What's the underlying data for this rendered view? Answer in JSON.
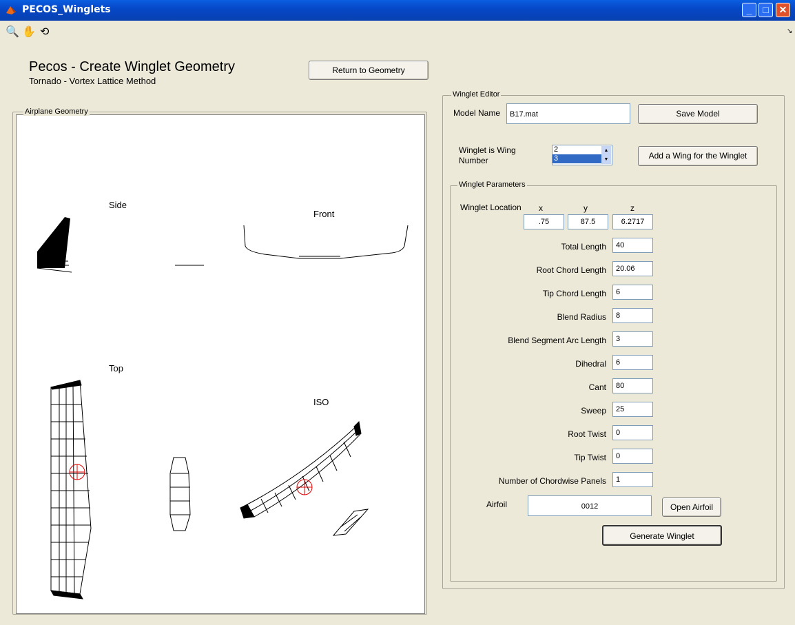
{
  "window": {
    "title": "PECOS_Winglets"
  },
  "toolbar": {
    "icons": [
      "zoom-in-icon",
      "pan-hand-icon",
      "rotate-3d-icon"
    ]
  },
  "header": {
    "title": "Pecos - Create Winglet Geometry",
    "subtitle": "Tornado - Vortex Lattice Method",
    "return_button": "Return to Geometry"
  },
  "geometry_panel": {
    "label": "Airplane Geometry",
    "views": {
      "side": "Side",
      "front": "Front",
      "top": "Top",
      "iso": "ISO"
    }
  },
  "editor": {
    "label": "Winglet Editor",
    "model_name_label": "Model Name",
    "model_name_value": "B17.mat",
    "save_button": "Save Model",
    "wing_number_label_1": "Winglet is Wing",
    "wing_number_label_2": "Number",
    "wing_list": [
      "2",
      "3"
    ],
    "wing_selected": "3",
    "add_wing_button": "Add a Wing for the Winglet"
  },
  "params": {
    "label": "Winglet Parameters",
    "location_label": "Winglet Location",
    "x_label": "x",
    "y_label": "y",
    "z_label": "z",
    "x": ".75",
    "y": "87.5",
    "z": "6.2717",
    "rows": [
      {
        "label": "Total Length",
        "value": "40"
      },
      {
        "label": "Root Chord Length",
        "value": "20.06"
      },
      {
        "label": "Tip Chord Length",
        "value": "6"
      },
      {
        "label": "Blend Radius",
        "value": "8"
      },
      {
        "label": "Blend Segment Arc Length",
        "value": "3"
      },
      {
        "label": "Dihedral",
        "value": "6"
      },
      {
        "label": "Cant",
        "value": "80"
      },
      {
        "label": "Sweep",
        "value": "25"
      },
      {
        "label": "Root Twist",
        "value": "0"
      },
      {
        "label": "Tip Twist",
        "value": "0"
      },
      {
        "label": "Number of Chordwise Panels",
        "value": "1"
      }
    ],
    "airfoil_label": "Airfoil",
    "airfoil_value": "0012",
    "open_airfoil_button": "Open Airfoil",
    "generate_button": "Generate Winglet"
  }
}
